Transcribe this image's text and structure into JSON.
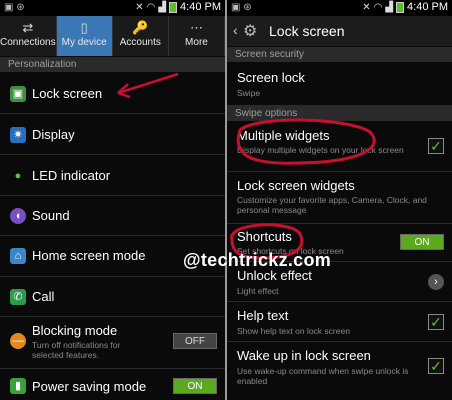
{
  "left": {
    "statusbar": {
      "time": "4:40 PM"
    },
    "tabs": [
      {
        "label": "Connections",
        "icon": "connections-icon",
        "active": false
      },
      {
        "label": "My device",
        "icon": "my-device-icon",
        "active": true
      },
      {
        "label": "Accounts",
        "icon": "accounts-icon",
        "active": false
      },
      {
        "label": "More",
        "icon": "more-icon",
        "active": false
      }
    ],
    "section": "Personalization",
    "items": [
      {
        "label": "Lock screen",
        "icon": "lock-screen-icon"
      },
      {
        "label": "Display",
        "icon": "display-icon"
      },
      {
        "label": "LED indicator",
        "icon": "led-indicator-icon"
      },
      {
        "label": "Sound",
        "icon": "sound-icon"
      },
      {
        "label": "Home screen mode",
        "icon": "home-icon"
      },
      {
        "label": "Call",
        "icon": "call-icon"
      },
      {
        "label": "Blocking mode",
        "sub": "Turn off notifications for selected features.",
        "icon": "blocking-icon",
        "toggle": "OFF"
      },
      {
        "label": "Power saving mode",
        "icon": "power-saving-icon",
        "toggle": "ON"
      }
    ]
  },
  "right": {
    "statusbar": {
      "time": "4:40 PM"
    },
    "title": "Lock screen",
    "sections": [
      "Screen security",
      "Swipe options"
    ],
    "items": [
      {
        "label": "Screen lock",
        "sub": "Swipe"
      },
      {
        "label": "Multiple widgets",
        "sub": "Display multiple widgets on your lock screen",
        "checked": true
      },
      {
        "label": "Lock screen widgets",
        "sub": "Customize your favorite apps, Camera, Clock, and personal message"
      },
      {
        "label": "Shortcuts",
        "sub": "Set shortcuts on lock screen",
        "toggle": "ON"
      },
      {
        "label": "Unlock effect",
        "sub": "Light effect"
      },
      {
        "label": "Help text",
        "sub": "Show help text on lock screen",
        "checked": true
      },
      {
        "label": "Wake up in lock screen",
        "sub": "Use wake-up command when swipe unlock is enabled",
        "checked": true
      }
    ]
  },
  "watermark": "@techtrickz.com",
  "colors": {
    "accent_tab": "#3a78b5",
    "toggle_on": "#5aa91e",
    "annotation": "#c8102e"
  }
}
